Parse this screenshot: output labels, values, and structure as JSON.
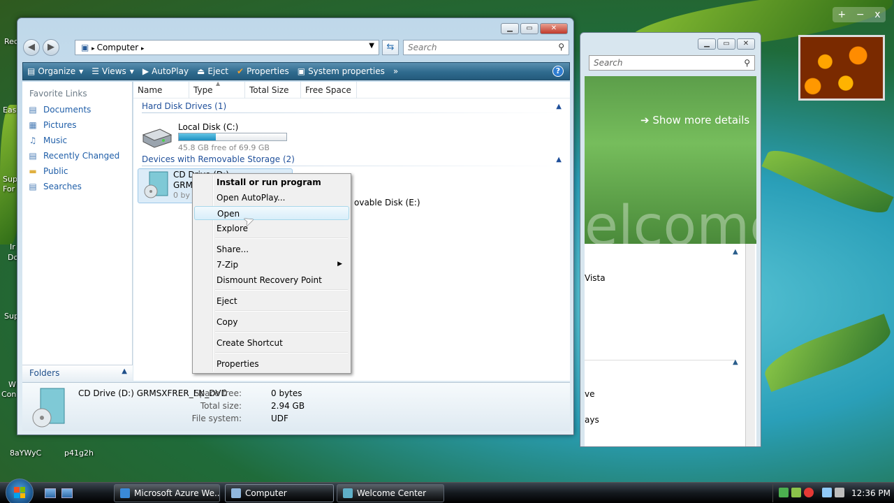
{
  "desktop": {
    "labels": [
      "8aYWyC",
      "p41g2h"
    ],
    "edge_labels": [
      "Rec",
      "Eas",
      "Sup",
      "For",
      "Ir",
      "Do",
      "Sup",
      "W",
      "Con"
    ]
  },
  "photo_gadget": {
    "controls": [
      "+",
      "−",
      "x"
    ]
  },
  "welcome_window": {
    "search_placeholder": "Search",
    "show_more": "Show more details",
    "banner_text": "elcome",
    "list_items": [
      "Vista",
      "ve",
      "ays"
    ]
  },
  "explorer": {
    "address": {
      "icon": "computer-icon",
      "path": "Computer",
      "separator": "▸"
    },
    "search_placeholder": "Search",
    "toolbar": {
      "organize": "Organize",
      "views": "Views",
      "autoplay": "AutoPlay",
      "eject": "Eject",
      "properties": "Properties",
      "system_properties": "System properties",
      "more": "»",
      "help": "?"
    },
    "nav_pane": {
      "header": "Favorite Links",
      "links": [
        "Documents",
        "Pictures",
        "Music",
        "Recently Changed",
        "Public",
        "Searches"
      ],
      "folders": "Folders"
    },
    "columns": [
      "Name",
      "Type",
      "Total Size",
      "Free Space"
    ],
    "groups": {
      "hard_disk": "Hard Disk Drives (1)",
      "removable": "Devices with Removable Storage (2)"
    },
    "drives": {
      "c": {
        "name": "Local Disk (C:)",
        "free": "45.8 GB free of 69.9 GB",
        "used_fraction": 0.345
      },
      "d": {
        "name": "CD Drive (D:)",
        "line2": "GRM",
        "line3": "0 by"
      },
      "e": {
        "name": "ovable Disk (E:)"
      }
    },
    "details": {
      "title": "CD Drive (D:) GRMSXFRER_EN_DVD",
      "space_free_label": "Space free:",
      "space_free": "0 bytes",
      "total_size_label": "Total size:",
      "total_size": "2.94 GB",
      "file_system_label": "File system:",
      "file_system": "UDF"
    }
  },
  "context_menu": {
    "items": [
      "Install or run program",
      "Open AutoPlay...",
      "Open",
      "Explore",
      "Share...",
      "7-Zip",
      "Dismount Recovery Point",
      "Eject",
      "Copy",
      "Create Shortcut",
      "Properties"
    ]
  },
  "taskbar": {
    "tasks": [
      "Microsoft Azure We...",
      "Computer",
      "Welcome Center"
    ],
    "clock": "12:36 PM"
  },
  "colors": {
    "toolbar": "#2f6b8e",
    "link": "#1f5ea8",
    "group_header": "#1f4f9a",
    "drive_fill": "#1d8fc0"
  }
}
